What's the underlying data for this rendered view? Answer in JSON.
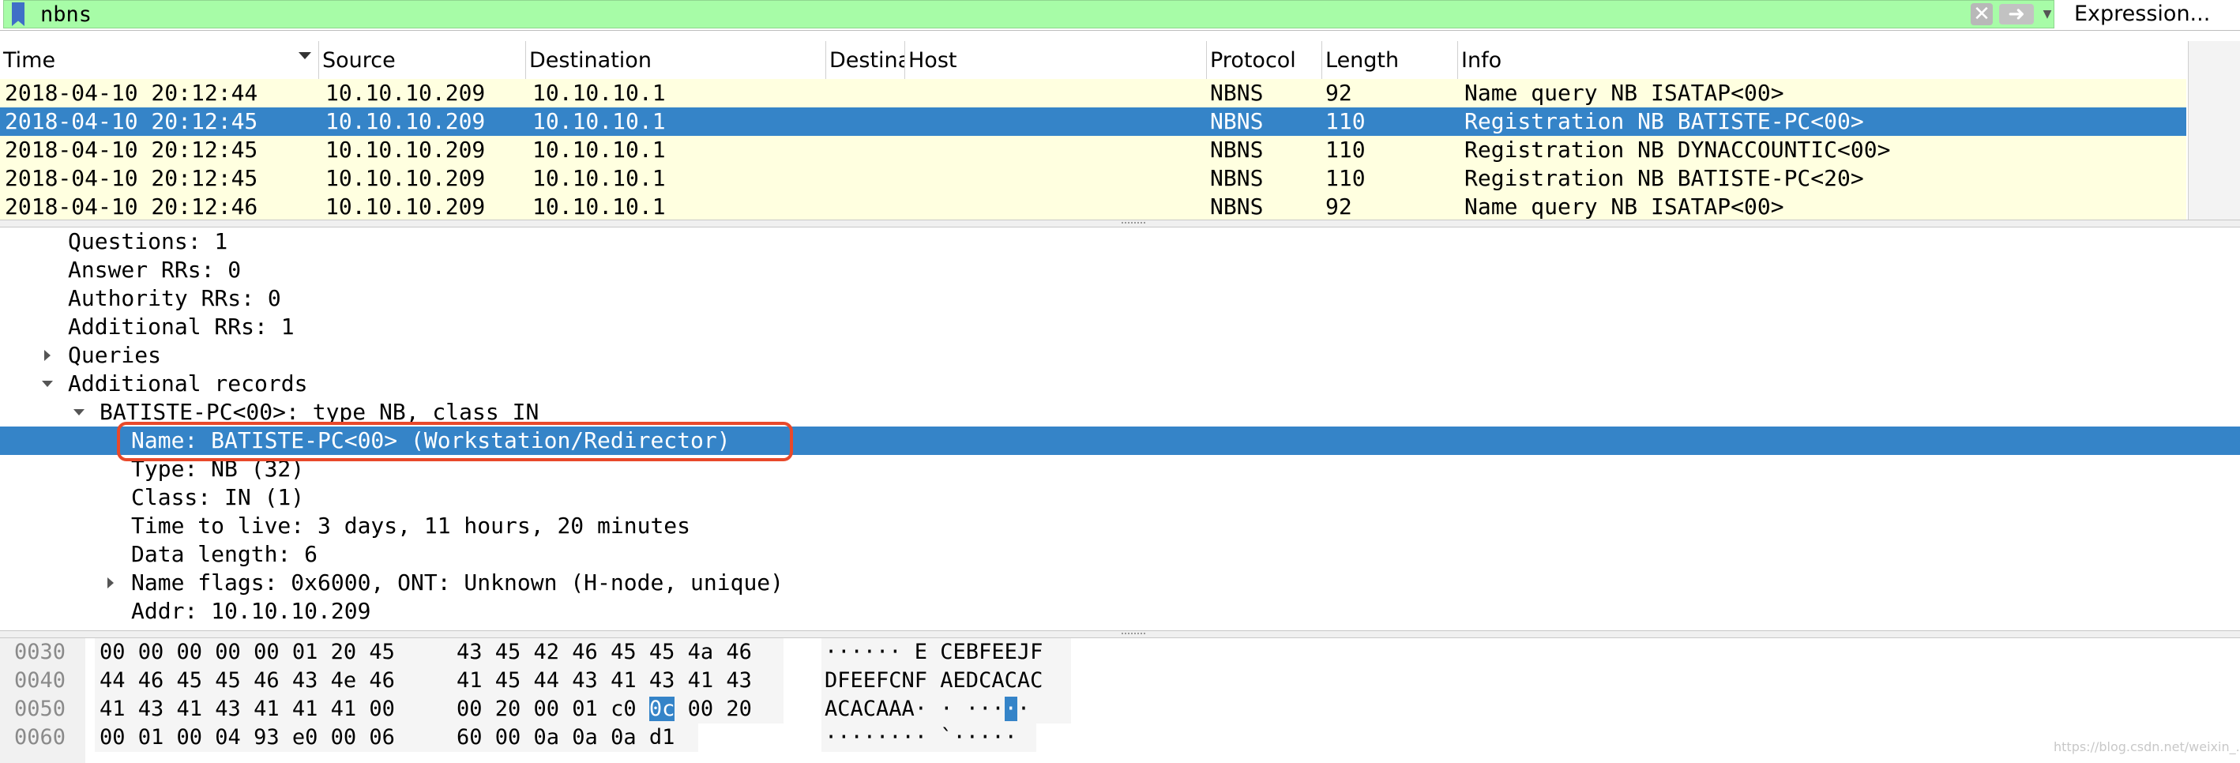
{
  "filter": {
    "value": "nbns",
    "expression_label": "Expression..."
  },
  "columns": [
    "Time",
    "Source",
    "Destination",
    "Destina",
    "Host",
    "Protocol",
    "Length",
    "Info"
  ],
  "packets": [
    {
      "time": "2018-04-10 20:12:44",
      "source": "10.10.10.209",
      "destination": "10.10.10.1",
      "protocol": "NBNS",
      "length": "92",
      "info": "Name query NB ISATAP<00>"
    },
    {
      "time": "2018-04-10 20:12:45",
      "source": "10.10.10.209",
      "destination": "10.10.10.1",
      "protocol": "NBNS",
      "length": "110",
      "info": "Registration NB BATISTE-PC<00>"
    },
    {
      "time": "2018-04-10 20:12:45",
      "source": "10.10.10.209",
      "destination": "10.10.10.1",
      "protocol": "NBNS",
      "length": "110",
      "info": "Registration NB DYNACCOUNTIC<00>"
    },
    {
      "time": "2018-04-10 20:12:45",
      "source": "10.10.10.209",
      "destination": "10.10.10.1",
      "protocol": "NBNS",
      "length": "110",
      "info": "Registration NB BATISTE-PC<20>"
    },
    {
      "time": "2018-04-10 20:12:46",
      "source": "10.10.10.209",
      "destination": "10.10.10.1",
      "protocol": "NBNS",
      "length": "92",
      "info": "Name query NB ISATAP<00>"
    }
  ],
  "details": [
    "Questions: 1",
    "Answer RRs: 0",
    "Authority RRs: 0",
    "Additional RRs: 1",
    "Queries",
    "Additional records",
    "BATISTE-PC<00>: type NB, class IN",
    "Name: BATISTE-PC<00> (Workstation/Redirector)",
    "Type: NB (32)",
    "Class: IN (1)",
    "Time to live: 3 days, 11 hours, 20 minutes",
    "Data length: 6",
    "Name flags: 0x6000, ONT: Unknown (H-node, unique)",
    "Addr: 10.10.10.209"
  ],
  "bytes": [
    {
      "offset": "0030",
      "hex1": "00 00 00 00 00 01 20 45",
      "hex2": "43 45 42 46 45 45 4a 46",
      "ascii": "······ E CEBFEEJF"
    },
    {
      "offset": "0040",
      "hex1": "44 46 45 45 46 43 4e 46",
      "hex2": "41 45 44 43 41 43 41 43",
      "ascii": "DFEEFCNF AEDCACAC"
    },
    {
      "offset": "0050",
      "hex1": "41 43 41 43 41 41 41 00",
      "hex2_pre": "00 20 00 01 c0 ",
      "hex2_hl": "0c",
      "hex2_post": " 00 20",
      "ascii_pre": "ACACAAA· · ···",
      "ascii_hl": "·",
      "ascii_post": "·"
    },
    {
      "offset": "0060",
      "hex1": "00 01 00 04 93 e0 00 06",
      "hex2": "60 00 0a 0a 0a d1",
      "ascii": "········ `·····"
    }
  ],
  "watermark": "https://blog.csdn.net/weixin_..."
}
